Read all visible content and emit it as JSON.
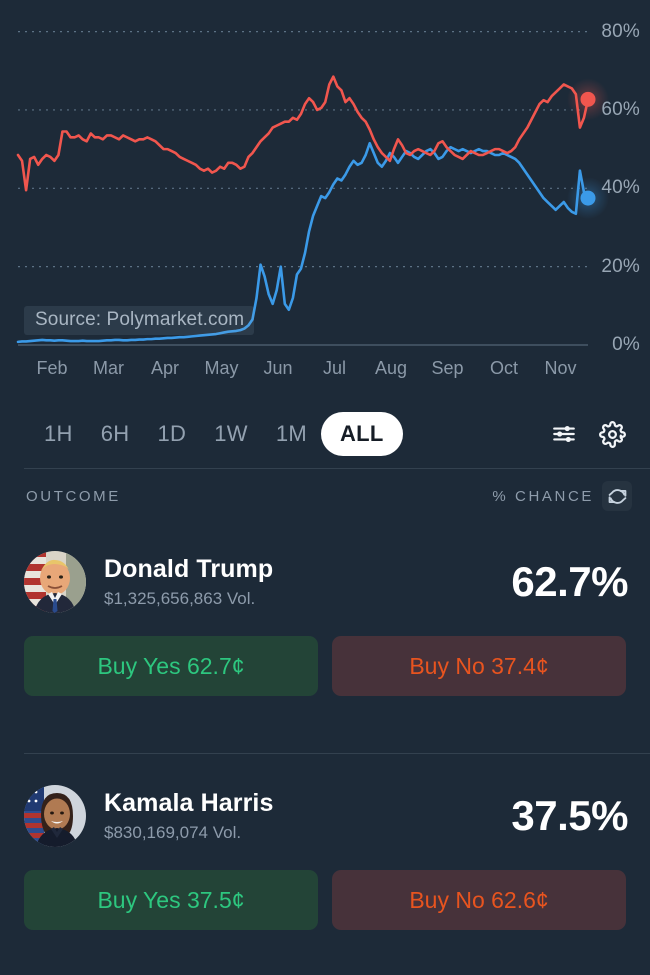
{
  "theme": {
    "background": "#1d2a38",
    "trump_color": "#f1564e",
    "harris_color": "#3b9ae8",
    "yes_color": "#2dc77f",
    "no_color": "#e8541f",
    "muted_text": "#8e9cab"
  },
  "chart_data": {
    "type": "line",
    "title": "",
    "xlabel": "",
    "ylabel": "",
    "ylim": [
      0,
      85
    ],
    "ytick_labels": [
      "80%",
      "60%",
      "40%",
      "20%",
      "0%"
    ],
    "yticks": [
      80,
      60,
      40,
      20,
      0
    ],
    "grid": "dotted-horizontal",
    "legend": "none",
    "watermark": "Source: Polymarket.com",
    "categories": [
      "Feb",
      "Mar",
      "Apr",
      "May",
      "Jun",
      "Jul",
      "Aug",
      "Sep",
      "Oct",
      "Nov"
    ],
    "xtick_labels": [
      "Feb",
      "Mar",
      "Apr",
      "May",
      "Jun",
      "Jul",
      "Aug",
      "Sep",
      "Oct",
      "Nov"
    ],
    "series": [
      {
        "name": "Donald Trump",
        "color": "#f1564e",
        "end_value": 62.7,
        "values": [
          48.5,
          47.0,
          39.5,
          47.5,
          48.0,
          46.0,
          47.5,
          48.5,
          48.0,
          47.0,
          48.5,
          54.5,
          54.5,
          53.0,
          53.0,
          53.5,
          52.5,
          52.0,
          54.0,
          53.0,
          53.0,
          52.5,
          53.5,
          53.5,
          53.0,
          52.5,
          53.5,
          53.0,
          52.5,
          52.0,
          52.5,
          52.5,
          53.0,
          52.5,
          52.0,
          51.0,
          50.0,
          50.0,
          49.5,
          49.0,
          48.0,
          47.5,
          47.0,
          46.5,
          46.0,
          45.0,
          44.5,
          45.0,
          44.0,
          44.5,
          45.5,
          45.0,
          46.5,
          46.5,
          46.0,
          45.0,
          45.5,
          48.0,
          49.0,
          50.5,
          52.0,
          53.0,
          54.0,
          55.5,
          56.0,
          56.5,
          57.0,
          57.0,
          58.0,
          57.5,
          59.0,
          61.5,
          63.0,
          62.0,
          60.0,
          60.5,
          62.0,
          66.5,
          68.5,
          66.0,
          65.0,
          62.0,
          63.0,
          61.5,
          59.5,
          58.0,
          57.0,
          55.0,
          52.5,
          50.5,
          49.0,
          48.0,
          47.0,
          50.0,
          52.5,
          51.0,
          49.0,
          48.5,
          49.5,
          50.0,
          49.5,
          49.0,
          48.5,
          49.5,
          51.5,
          52.0,
          50.5,
          49.5,
          48.5,
          48.0,
          47.5,
          48.5,
          49.5,
          49.0,
          48.5,
          48.5,
          49.0,
          49.5,
          50.0,
          50.0,
          49.5,
          49.0,
          49.5,
          50.5,
          52.5,
          54.0,
          55.5,
          57.5,
          59.5,
          61.5,
          62.5,
          62.0,
          63.5,
          64.5,
          65.5,
          66.5,
          66.0,
          65.5,
          64.0,
          55.5,
          58.0,
          62.7
        ]
      },
      {
        "name": "Kamala Harris",
        "color": "#3b9ae8",
        "end_value": 37.5,
        "values": [
          0.8,
          0.9,
          0.9,
          1.0,
          1.1,
          1.2,
          1.3,
          1.2,
          1.2,
          1.1,
          1.2,
          1.2,
          1.1,
          1.0,
          1.0,
          1.0,
          1.1,
          1.0,
          1.0,
          1.0,
          1.0,
          1.1,
          1.2,
          1.2,
          1.3,
          1.3,
          1.2,
          1.2,
          1.3,
          1.3,
          1.4,
          1.4,
          1.5,
          1.5,
          1.6,
          1.6,
          1.7,
          1.8,
          1.8,
          1.9,
          2.0,
          2.0,
          2.1,
          2.2,
          2.3,
          2.4,
          2.5,
          2.6,
          2.7,
          2.8,
          3.0,
          3.2,
          3.4,
          3.5,
          3.6,
          3.8,
          4.2,
          5.0,
          6.5,
          12.0,
          20.5,
          17.5,
          13.0,
          10.5,
          14.0,
          20.0,
          10.5,
          9.0,
          12.0,
          18.0,
          19.5,
          23.5,
          29.0,
          33.0,
          35.5,
          38.0,
          37.5,
          39.0,
          41.0,
          42.5,
          42.0,
          43.5,
          45.5,
          47.0,
          46.0,
          46.5,
          48.5,
          51.5,
          49.0,
          46.5,
          45.5,
          47.0,
          49.0,
          48.0,
          46.5,
          48.0,
          49.5,
          49.0,
          48.0,
          47.5,
          48.5,
          49.5,
          50.0,
          49.0,
          47.5,
          48.0,
          49.5,
          50.5,
          50.0,
          49.5,
          50.0,
          49.5,
          49.0,
          49.5,
          50.0,
          49.5,
          49.5,
          49.0,
          48.5,
          48.5,
          49.0,
          48.5,
          48.0,
          47.5,
          46.5,
          45.0,
          43.5,
          42.0,
          40.5,
          39.0,
          37.5,
          36.5,
          35.5,
          34.5,
          35.5,
          36.5,
          35.0,
          34.0,
          33.5,
          44.5,
          39.0,
          37.5
        ]
      }
    ]
  },
  "range_bar": {
    "options": [
      {
        "label": "1H",
        "active": false
      },
      {
        "label": "6H",
        "active": false
      },
      {
        "label": "1D",
        "active": false
      },
      {
        "label": "1W",
        "active": false
      },
      {
        "label": "1M",
        "active": false
      },
      {
        "label": "ALL",
        "active": true
      }
    ],
    "filter_icon": "sliders-icon",
    "settings_icon": "gear-icon"
  },
  "table": {
    "col_outcome": "OUTCOME",
    "col_chance": "% CHANCE",
    "refresh_icon": "refresh-icon",
    "rows": [
      {
        "name": "Donald Trump",
        "volume": "$1,325,656,863 Vol.",
        "chance": "62.7%",
        "buy_yes": "Buy Yes 62.7¢",
        "buy_no": "Buy No 37.4¢",
        "avatar": "trump-avatar"
      },
      {
        "name": "Kamala Harris",
        "volume": "$830,169,074 Vol.",
        "chance": "37.5%",
        "buy_yes": "Buy Yes 37.5¢",
        "buy_no": "Buy No 62.6¢",
        "avatar": "harris-avatar"
      }
    ]
  }
}
